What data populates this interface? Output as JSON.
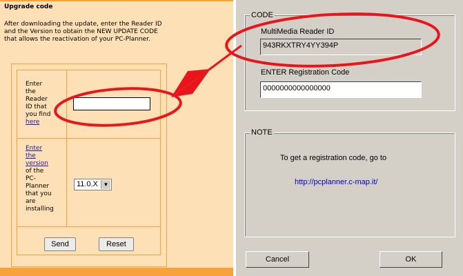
{
  "webform": {
    "title": "Upgrade code",
    "description": "After downloading the update, enter the Reader ID and the Version to obtain the NEW UPDATE CODE that allows the reactivation of your PC-Planner.",
    "reader_label_lines": [
      "Enter",
      "the",
      "Reader",
      "ID that",
      "you find"
    ],
    "reader_link": "here",
    "reader_input_value": "",
    "version_link_lines": [
      "Enter",
      "the",
      "version"
    ],
    "version_label_lines": [
      "of the",
      "PC-",
      "Planner",
      "that you",
      "are",
      "installing"
    ],
    "version_selected": "11.0.X",
    "send_label": "Send",
    "reset_label": "Reset"
  },
  "dialog": {
    "code_group_title": "CODE",
    "reader_id_label": "MultiMedia Reader ID",
    "reader_id_value": "943RKXTRY4YY394P",
    "reg_code_label": "ENTER Registration Code",
    "reg_code_value": "0000000000000000",
    "note_group_title": "NOTE",
    "note_text": "To get a registration code, go to",
    "note_link": "http://pcplanner.c-map.it/",
    "cancel_label": "Cancel",
    "ok_label": "OK"
  },
  "colors": {
    "web_background": "#fde0b6",
    "web_border": "#f7a23b",
    "dialog_background": "#d4d0c8",
    "annotation": "#e8161b",
    "link": "#0000cc"
  }
}
